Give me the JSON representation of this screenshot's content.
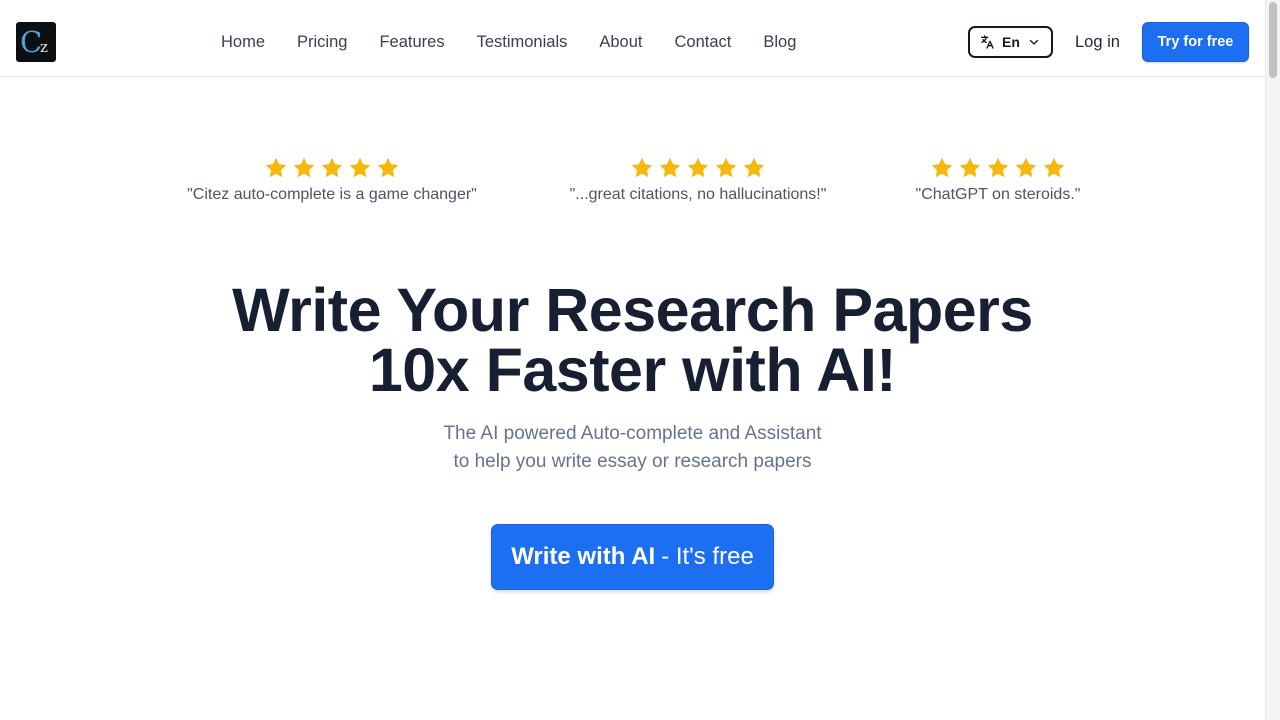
{
  "header": {
    "logo": {
      "c": "C",
      "z": "z"
    },
    "nav": [
      "Home",
      "Pricing",
      "Features",
      "Testimonials",
      "About",
      "Contact",
      "Blog"
    ],
    "language": {
      "label": "En",
      "icon": "translate-icon"
    },
    "login_label": "Log in",
    "try_label": "Try for free"
  },
  "testimonials": [
    {
      "rating": 5,
      "quote": "\"Citez auto-complete is a game changer\""
    },
    {
      "rating": 5,
      "quote": "\"...great citations, no hallucinations!\""
    },
    {
      "rating": 5,
      "quote": "\"ChatGPT on steroids.\""
    }
  ],
  "hero": {
    "title_line1": "Write Your Research Papers",
    "title_line2": "10x Faster with AI!",
    "subtitle_line1": "The AI powered Auto-complete and Assistant",
    "subtitle_line2": "to help you write essay or research papers",
    "cta_strong": "Write with AI",
    "cta_light": "- It's free"
  },
  "colors": {
    "accent": "#1d6ff2",
    "star": "#f5b80b",
    "heading": "#172033",
    "muted": "#64748b"
  }
}
